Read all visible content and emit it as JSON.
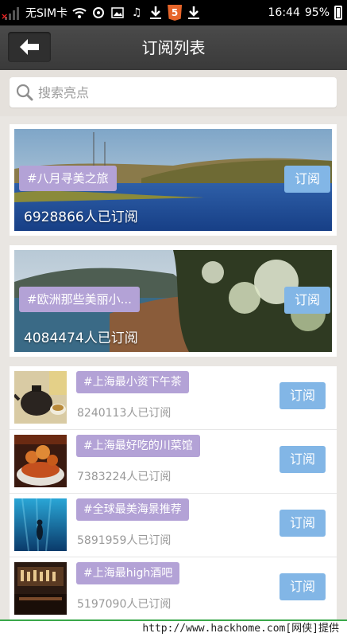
{
  "status_bar": {
    "carrier": "无SIM卡",
    "time": "16:44",
    "battery": "95%"
  },
  "header": {
    "title": "订阅列表"
  },
  "search": {
    "placeholder": "搜索亮点"
  },
  "banners": [
    {
      "tag": "#八月寻美之旅",
      "count": "6928866人已订阅",
      "button": "订阅"
    },
    {
      "tag": "#欧洲那些美丽小...",
      "count": "4084474人已订阅",
      "button": "订阅"
    }
  ],
  "list": [
    {
      "tag": "#上海最小资下午茶",
      "count": "8240113人已订阅",
      "button": "订阅"
    },
    {
      "tag": "#上海最好吃的川菜馆",
      "count": "7383224人已订阅",
      "button": "订阅"
    },
    {
      "tag": "#全球最美海景推荐",
      "count": "5891959人已订阅",
      "button": "订阅"
    },
    {
      "tag": "#上海最high酒吧",
      "count": "5197090人已订阅",
      "button": "订阅"
    }
  ],
  "footer": {
    "watermark": "http://www.hackhome.com[网侠]提供"
  },
  "colors": {
    "tag_purple": "#b3a2d6",
    "subscribe_blue": "#82b6e6",
    "header_bg": "#404040"
  }
}
